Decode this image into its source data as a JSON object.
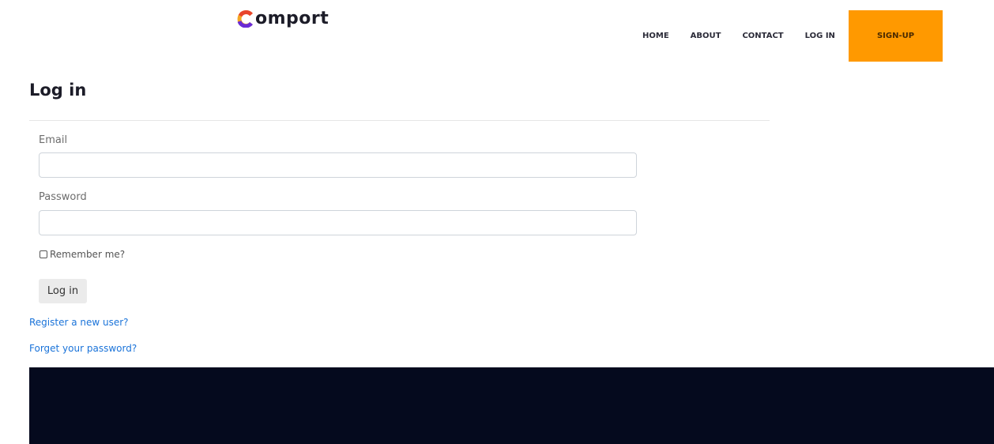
{
  "brand": {
    "name": "omport"
  },
  "nav": {
    "items": [
      {
        "label": "HOME"
      },
      {
        "label": "ABOUT"
      },
      {
        "label": "CONTACT"
      },
      {
        "label": "LOG IN"
      }
    ],
    "signup_label": "SIGN-UP",
    "signup_color": "#ff9900"
  },
  "page": {
    "title": "Log in"
  },
  "form": {
    "email_label": "Email",
    "email_value": "",
    "password_label": "Password",
    "password_value": "",
    "remember_label": "Remember me?",
    "remember_checked": false,
    "submit_label": "Log in"
  },
  "links": {
    "register": "Register a new user?",
    "forgot": "Forget your password?"
  },
  "colors": {
    "accent": "#ff9900",
    "link": "#1a73d9",
    "footer": "#050a1e"
  }
}
